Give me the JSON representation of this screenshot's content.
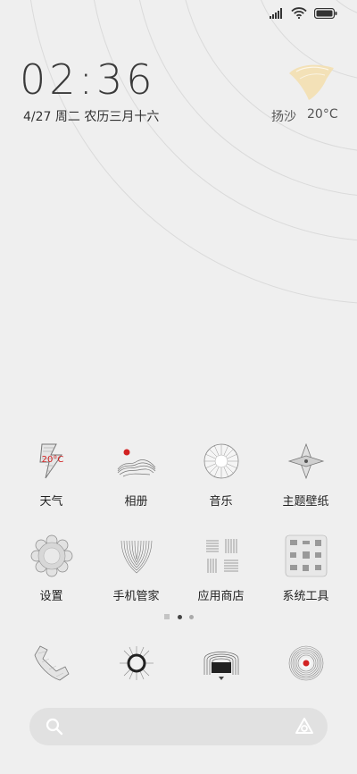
{
  "status": {
    "signal_icon": "signal-icon",
    "wifi_icon": "wifi-icon",
    "battery_icon": "battery-icon"
  },
  "clock": {
    "time": "02:36",
    "date": "4/27 周二 农历三月十六"
  },
  "weather": {
    "location": "扬沙",
    "temperature": "20°C",
    "icon": "sandstorm-icon"
  },
  "apps": [
    {
      "label": "天气",
      "icon": "weather-app-icon",
      "badge": "20°C"
    },
    {
      "label": "相册",
      "icon": "gallery-icon"
    },
    {
      "label": "音乐",
      "icon": "music-icon"
    },
    {
      "label": "主题壁纸",
      "icon": "themes-icon"
    },
    {
      "label": "设置",
      "icon": "settings-icon"
    },
    {
      "label": "手机管家",
      "icon": "security-icon"
    },
    {
      "label": "应用商店",
      "icon": "app-store-icon"
    },
    {
      "label": "系统工具",
      "icon": "tools-folder-icon"
    }
  ],
  "pager": {
    "pages": 3,
    "current": 2
  },
  "dock": [
    {
      "icon": "phone-icon"
    },
    {
      "icon": "messages-icon"
    },
    {
      "icon": "browser-icon"
    },
    {
      "icon": "camera-icon"
    }
  ],
  "search": {
    "search_icon": "search-icon",
    "assistant_icon": "assistant-icon"
  },
  "colors": {
    "background": "#efefef",
    "accent_red": "#d22222",
    "weather_yellow": "#f3dfb0"
  }
}
